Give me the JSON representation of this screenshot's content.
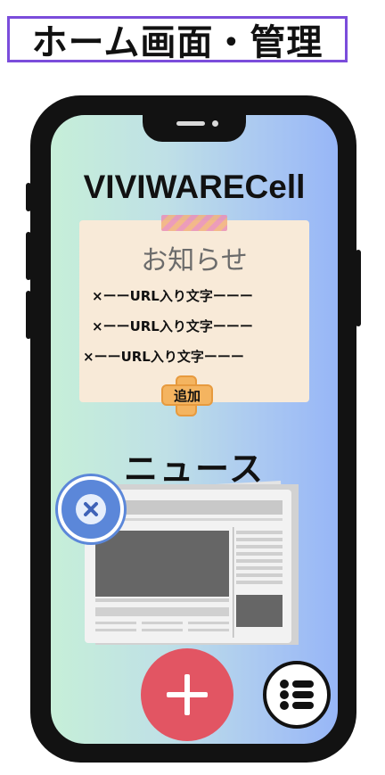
{
  "page_title": "ホーム画面・管理",
  "app": {
    "title": "VIVIWARECell"
  },
  "notice": {
    "title": "お知らせ",
    "items": [
      "×ーーURL入り文字ーーー",
      "×ーーURL入り文字ーーー",
      "×ーーURL入り文字ーーー"
    ],
    "add_label": "追加"
  },
  "news": {
    "title": "ニュース"
  },
  "icons": {
    "close": "close-icon",
    "newspaper": "newspaper-icon",
    "add": "plus-icon",
    "menu": "list-menu-icon"
  },
  "colors": {
    "frame": "#121212",
    "page_title_border": "#7b4ddb",
    "notice_card": "#f8ead8",
    "add_button": "#f4b460",
    "close_button": "#5b87d9",
    "add_fab": "#e25563",
    "screen_gradient_start": "#c6efd8",
    "screen_gradient_end": "#97b6f7"
  }
}
